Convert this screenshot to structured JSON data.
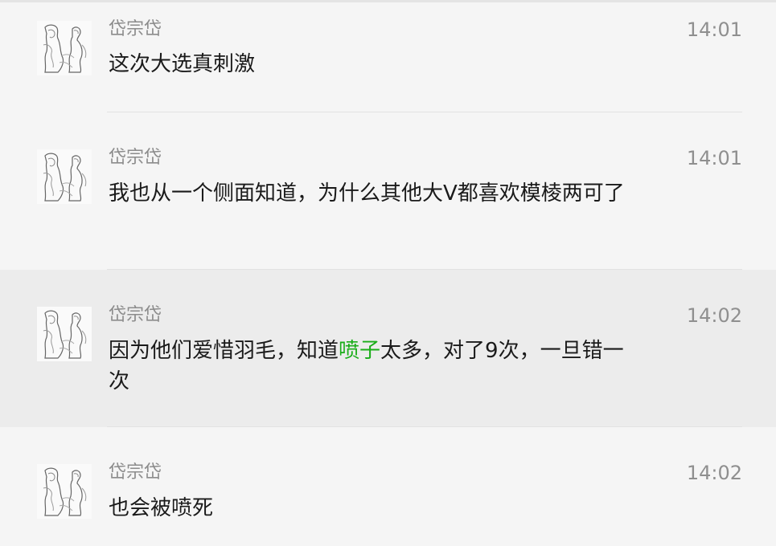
{
  "messages": [
    {
      "sender": "岱宗岱",
      "time": "14:01",
      "text": "这次大选真刺激"
    },
    {
      "sender": "岱宗岱",
      "time": "14:01",
      "text": "我也从一个侧面知道，为什么其他大V都喜欢模棱两可了"
    },
    {
      "sender": "岱宗岱",
      "time": "14:02",
      "text_before": "因为他们爱惜羽毛，知道",
      "text_link": "喷子",
      "text_after": "太多，对了9次，一旦错一次"
    },
    {
      "sender": "岱宗岱",
      "time": "14:02",
      "text": "也会被喷死"
    }
  ],
  "colors": {
    "background": "#f5f5f5",
    "hover_background": "#ececec",
    "name": "#8c8c8c",
    "time": "#8f8f8f",
    "text": "#1a1a1a",
    "link": "#1aad19",
    "separator": "#e2e2e2"
  },
  "icons": {
    "avatar": "sketch-figures-avatar"
  }
}
